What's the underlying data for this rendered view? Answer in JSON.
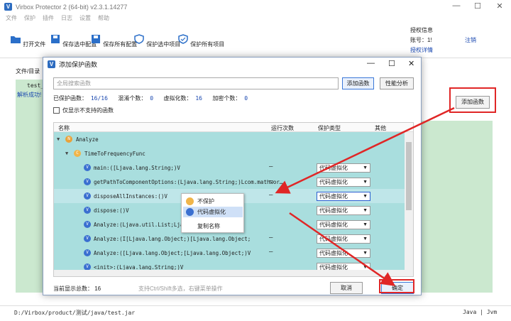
{
  "window": {
    "title": "Virbox Protector 2 (64-bit) v2.3.1.14277",
    "logo": "V"
  },
  "menu": [
    "文件",
    "保护",
    "插件",
    "日志",
    "设置",
    "帮助"
  ],
  "toolbar": {
    "open": "打开文件",
    "save_selected": "保存选中配置",
    "save_all": "保存所有配置",
    "protect_selected": "保护选中项目",
    "protect_all": "保护所有项目"
  },
  "license": {
    "title": "授权信息",
    "account_label": "账号：",
    "account_value": "1!",
    "logout": "注销",
    "detail": "授权详情"
  },
  "left_panel": {
    "tab": "文件/目录",
    "file": "test_",
    "status": "解析成功!"
  },
  "statusbar": {
    "path": "D:/Virbox/product/测试/java/test.jar",
    "mode": "Java | Jvm"
  },
  "outer_add_button": "添加函数",
  "dialog": {
    "title": "添加保护函数",
    "logo": "V",
    "search_placeholder": "全局搜索函数",
    "add_button": "添加函数",
    "perf_button": "性能分析",
    "stats": {
      "protected_label": "已保护函数：",
      "protected_value": "16/16",
      "obfuscated_label": "混淆个数：",
      "obfuscated_value": "0",
      "virtualized_label": "虚拟化数：",
      "virtualized_value": "16",
      "encrypted_label": "加密个数：",
      "encrypted_value": "0"
    },
    "only_unsupported": "仅显示不支持的函数",
    "columns": {
      "name": "名称",
      "runs": "运行次数",
      "type": "保护类型",
      "other": "其他"
    },
    "tree": {
      "root": "Analyze",
      "class": "TimeToFrequencyFunc",
      "rows": [
        {
          "name": "main:([Ljava.lang.String;)V",
          "runs": "—",
          "type": "代码虚拟化"
        },
        {
          "name": "getPathToComponentOptions:(Ljava.lang.String;)Lcom.mathwor…",
          "runs": "—",
          "type": "代码虚拟化"
        },
        {
          "name": "disposeAllInstances:()V",
          "runs": "—",
          "type": "代码虚拟化"
        },
        {
          "name": "dispose:()V",
          "runs": "",
          "type": "代码虚拟化"
        },
        {
          "name": "Analyze:(Ljava.util.List;Ljava",
          "runs": "",
          "type": "代码虚拟化"
        },
        {
          "name": "Analyze:(I[Ljava.lang.Object;)[Ljava.lang.Object;",
          "runs": "—",
          "type": "代码虚拟化"
        },
        {
          "name": "Analyze:([Ljava.lang.Object;[Ljava.lang.Object;)V",
          "runs": "—",
          "type": "代码虚拟化"
        },
        {
          "name": "<init>:(Ljava.lang.String;)V",
          "runs": "",
          "type": "代码虚拟化"
        }
      ]
    },
    "context_menu": {
      "no_protect": "不保护",
      "virtualize": "代码虚拟化",
      "copy_name": "复制名称"
    },
    "footer": {
      "total_label": "当前显示总数：",
      "total_value": "16",
      "hint": "支持Ctrl/Shift多选，右键菜单操作",
      "cancel": "取消",
      "ok": "确定"
    }
  },
  "colors": {
    "annotation_red": "#e02626",
    "tree_bg": "#a9dede",
    "panel_green": "#cbe8cf",
    "accent_blue": "#3b78d8"
  }
}
